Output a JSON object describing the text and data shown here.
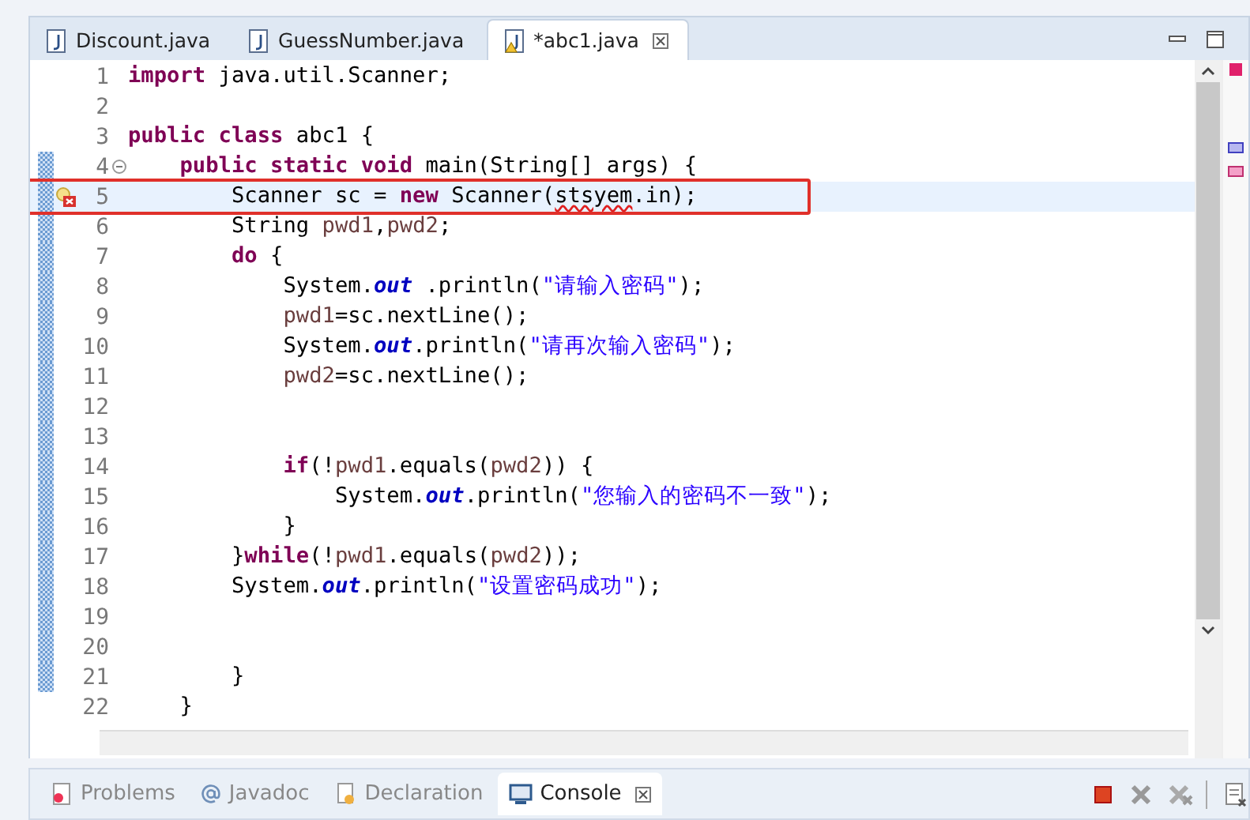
{
  "editor_tabs": [
    {
      "label": "Discount.java",
      "selected": false,
      "dirty_warning": false
    },
    {
      "label": "GuessNumber.java",
      "selected": false,
      "dirty_warning": false
    },
    {
      "label": "*abc1.java",
      "selected": true,
      "dirty_warning": true
    }
  ],
  "lines": [
    {
      "number": "1",
      "changed": false,
      "current": false,
      "error": false,
      "fold": false,
      "tokens": [
        {
          "kind": "kw",
          "text": "import"
        },
        {
          "kind": "plain",
          "text": " java.util.Scanner;"
        }
      ]
    },
    {
      "number": "2",
      "changed": false,
      "current": false,
      "error": false,
      "fold": false
    },
    {
      "number": "3",
      "changed": false,
      "current": false,
      "error": false,
      "fold": false,
      "tokens": [
        {
          "kind": "kw",
          "text": "public class"
        },
        {
          "kind": "plain",
          "text": " abc1 {"
        }
      ]
    },
    {
      "number": "4",
      "changed": true,
      "current": false,
      "error": false,
      "fold": true,
      "tokens": [
        {
          "kind": "kw",
          "text": "    public static void"
        },
        {
          "kind": "plain",
          "text": " main(String[] args) {"
        }
      ]
    },
    {
      "number": "5",
      "changed": true,
      "current": true,
      "error": true,
      "fold": false,
      "tokens": [
        {
          "kind": "plain",
          "text": "        Scanner sc = "
        },
        {
          "kind": "kw",
          "text": "new"
        },
        {
          "kind": "plain",
          "text": " Scanner("
        },
        {
          "kind": "err",
          "text": "stsyem"
        },
        {
          "kind": "plain",
          "text": ".in);"
        }
      ]
    },
    {
      "number": "6",
      "changed": true,
      "current": false,
      "error": false,
      "fold": false,
      "tokens": [
        {
          "kind": "plain",
          "text": "        String "
        },
        {
          "kind": "local",
          "text": "pwd1"
        },
        {
          "kind": "plain",
          "text": ","
        },
        {
          "kind": "local",
          "text": "pwd2"
        },
        {
          "kind": "plain",
          "text": ";"
        }
      ]
    },
    {
      "number": "7",
      "changed": true,
      "current": false,
      "error": false,
      "fold": false,
      "tokens": [
        {
          "kind": "kw",
          "text": "        do"
        },
        {
          "kind": "plain",
          "text": " {"
        }
      ]
    },
    {
      "number": "8",
      "changed": true,
      "current": false,
      "error": false,
      "fold": false,
      "tokens": [
        {
          "kind": "plain",
          "text": "            System."
        },
        {
          "kind": "field",
          "text": "out"
        },
        {
          "kind": "plain",
          "text": " .println("
        },
        {
          "kind": "str",
          "text": "\"请输入密码\""
        },
        {
          "kind": "plain",
          "text": ");"
        }
      ]
    },
    {
      "number": "9",
      "changed": true,
      "current": false,
      "error": false,
      "fold": false,
      "tokens": [
        {
          "kind": "local",
          "text": "            pwd1"
        },
        {
          "kind": "plain",
          "text": "=sc.nextLine();"
        }
      ]
    },
    {
      "number": "10",
      "changed": true,
      "current": false,
      "error": false,
      "fold": false,
      "tokens": [
        {
          "kind": "plain",
          "text": "            System."
        },
        {
          "kind": "field",
          "text": "out"
        },
        {
          "kind": "plain",
          "text": ".println("
        },
        {
          "kind": "str",
          "text": "\"请再次输入密码\""
        },
        {
          "kind": "plain",
          "text": ");"
        }
      ]
    },
    {
      "number": "11",
      "changed": true,
      "current": false,
      "error": false,
      "fold": false,
      "tokens": [
        {
          "kind": "local",
          "text": "            pwd2"
        },
        {
          "kind": "plain",
          "text": "=sc.nextLine();"
        }
      ]
    },
    {
      "number": "12",
      "changed": true,
      "current": false,
      "error": false,
      "fold": false
    },
    {
      "number": "13",
      "changed": true,
      "current": false,
      "error": false,
      "fold": false
    },
    {
      "number": "14",
      "changed": true,
      "current": false,
      "error": false,
      "fold": false,
      "tokens": [
        {
          "kind": "kw",
          "text": "            if"
        },
        {
          "kind": "plain",
          "text": "(!"
        },
        {
          "kind": "local",
          "text": "pwd1"
        },
        {
          "kind": "plain",
          "text": ".equals("
        },
        {
          "kind": "local",
          "text": "pwd2"
        },
        {
          "kind": "plain",
          "text": ")) {"
        }
      ]
    },
    {
      "number": "15",
      "changed": true,
      "current": false,
      "error": false,
      "fold": false,
      "tokens": [
        {
          "kind": "plain",
          "text": "                System."
        },
        {
          "kind": "field",
          "text": "out"
        },
        {
          "kind": "plain",
          "text": ".println("
        },
        {
          "kind": "str",
          "text": "\"您输入的密码不一致\""
        },
        {
          "kind": "plain",
          "text": ");"
        }
      ]
    },
    {
      "number": "16",
      "changed": true,
      "current": false,
      "error": false,
      "fold": false,
      "tokens": [
        {
          "kind": "plain",
          "text": "            }"
        }
      ]
    },
    {
      "number": "17",
      "changed": true,
      "current": false,
      "error": false,
      "fold": false,
      "tokens": [
        {
          "kind": "plain",
          "text": "        }"
        },
        {
          "kind": "kw",
          "text": "while"
        },
        {
          "kind": "plain",
          "text": "(!"
        },
        {
          "kind": "local",
          "text": "pwd1"
        },
        {
          "kind": "plain",
          "text": ".equals("
        },
        {
          "kind": "local",
          "text": "pwd2"
        },
        {
          "kind": "plain",
          "text": "));"
        }
      ]
    },
    {
      "number": "18",
      "changed": true,
      "current": false,
      "error": false,
      "fold": false,
      "tokens": [
        {
          "kind": "plain",
          "text": "        System."
        },
        {
          "kind": "field",
          "text": "out"
        },
        {
          "kind": "plain",
          "text": ".println("
        },
        {
          "kind": "str",
          "text": "\"设置密码成功\""
        },
        {
          "kind": "plain",
          "text": ");"
        }
      ]
    },
    {
      "number": "19",
      "changed": true,
      "current": false,
      "error": false,
      "fold": false
    },
    {
      "number": "20",
      "changed": true,
      "current": false,
      "error": false,
      "fold": false
    },
    {
      "number": "21",
      "changed": true,
      "current": false,
      "error": false,
      "fold": false,
      "tokens": [
        {
          "kind": "plain",
          "text": "        }"
        }
      ]
    },
    {
      "number": "22",
      "changed": false,
      "current": false,
      "error": false,
      "fold": false,
      "tokens": [
        {
          "kind": "plain",
          "text": "    }"
        }
      ]
    }
  ],
  "panel_tabs": [
    {
      "label": "Problems",
      "kind": "problems",
      "selected": false
    },
    {
      "label": "Javadoc",
      "kind": "javadoc",
      "selected": false
    },
    {
      "label": "Declaration",
      "kind": "declaration",
      "selected": false
    },
    {
      "label": "Console",
      "kind": "console",
      "selected": true
    }
  ]
}
